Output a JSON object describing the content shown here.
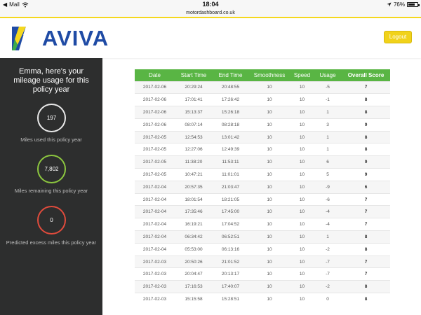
{
  "status_bar": {
    "carrier": "Mail",
    "time": "18:04",
    "battery": "76%",
    "battery_level": 0.76
  },
  "browser": {
    "url": "motordashboard.co.uk"
  },
  "header": {
    "brand": "AVIVA",
    "logout_label": "Logout"
  },
  "colors": {
    "brand_blue": "#1f4ba5",
    "brand_yellow": "#f5d81e",
    "table_header_green": "#59b544",
    "ring_white": "#e8e8e8",
    "ring_green": "#8cc63f",
    "ring_red": "#e04b3c",
    "sidebar_bg": "#2d2e2e"
  },
  "sidebar": {
    "title": "Emma, here's your mileage usage for this policy year",
    "stats": [
      {
        "value": "197",
        "label": "Miles used this policy year",
        "ring": "white"
      },
      {
        "value": "7,802",
        "label": "Miles remaining this policy year",
        "ring": "green"
      },
      {
        "value": "0",
        "label": "Predicted excess miles this policy year",
        "ring": "red"
      }
    ]
  },
  "table": {
    "columns": [
      "Date",
      "Start Time",
      "End Time",
      "Smoothness",
      "Speed",
      "Usage",
      "Overall Score"
    ],
    "rows": [
      [
        "2017-02-06",
        "20:29:24",
        "20:48:55",
        "10",
        "10",
        "-5",
        "7"
      ],
      [
        "2017-02-06",
        "17:01:41",
        "17:26:42",
        "10",
        "10",
        "-1",
        "8"
      ],
      [
        "2017-02-06",
        "15:13:37",
        "15:26:18",
        "10",
        "10",
        "1",
        "8"
      ],
      [
        "2017-02-06",
        "08:07:14",
        "08:28:18",
        "10",
        "10",
        "3",
        "9"
      ],
      [
        "2017-02-05",
        "12:54:53",
        "13:01:42",
        "10",
        "10",
        "1",
        "8"
      ],
      [
        "2017-02-05",
        "12:27:06",
        "12:49:39",
        "10",
        "10",
        "1",
        "8"
      ],
      [
        "2017-02-05",
        "11:38:20",
        "11:53:11",
        "10",
        "10",
        "6",
        "9"
      ],
      [
        "2017-02-05",
        "10:47:21",
        "11:01:01",
        "10",
        "10",
        "5",
        "9"
      ],
      [
        "2017-02-04",
        "20:57:35",
        "21:03:47",
        "10",
        "10",
        "-9",
        "6"
      ],
      [
        "2017-02-04",
        "18:01:54",
        "18:21:05",
        "10",
        "10",
        "-6",
        "7"
      ],
      [
        "2017-02-04",
        "17:35:46",
        "17:45:00",
        "10",
        "10",
        "-4",
        "7"
      ],
      [
        "2017-02-04",
        "16:19:21",
        "17:04:52",
        "10",
        "10",
        "-4",
        "7"
      ],
      [
        "2017-02-04",
        "06:34:42",
        "06:52:51",
        "10",
        "10",
        "1",
        "8"
      ],
      [
        "2017-02-04",
        "05:53:00",
        "06:13:16",
        "10",
        "10",
        "-2",
        "8"
      ],
      [
        "2017-02-03",
        "20:50:26",
        "21:01:52",
        "10",
        "10",
        "-7",
        "7"
      ],
      [
        "2017-02-03",
        "20:04:47",
        "20:13:17",
        "10",
        "10",
        "-7",
        "7"
      ],
      [
        "2017-02-03",
        "17:16:53",
        "17:40:07",
        "10",
        "10",
        "-2",
        "8"
      ],
      [
        "2017-02-03",
        "15:15:58",
        "15:28:51",
        "10",
        "10",
        "0",
        "8"
      ]
    ]
  }
}
